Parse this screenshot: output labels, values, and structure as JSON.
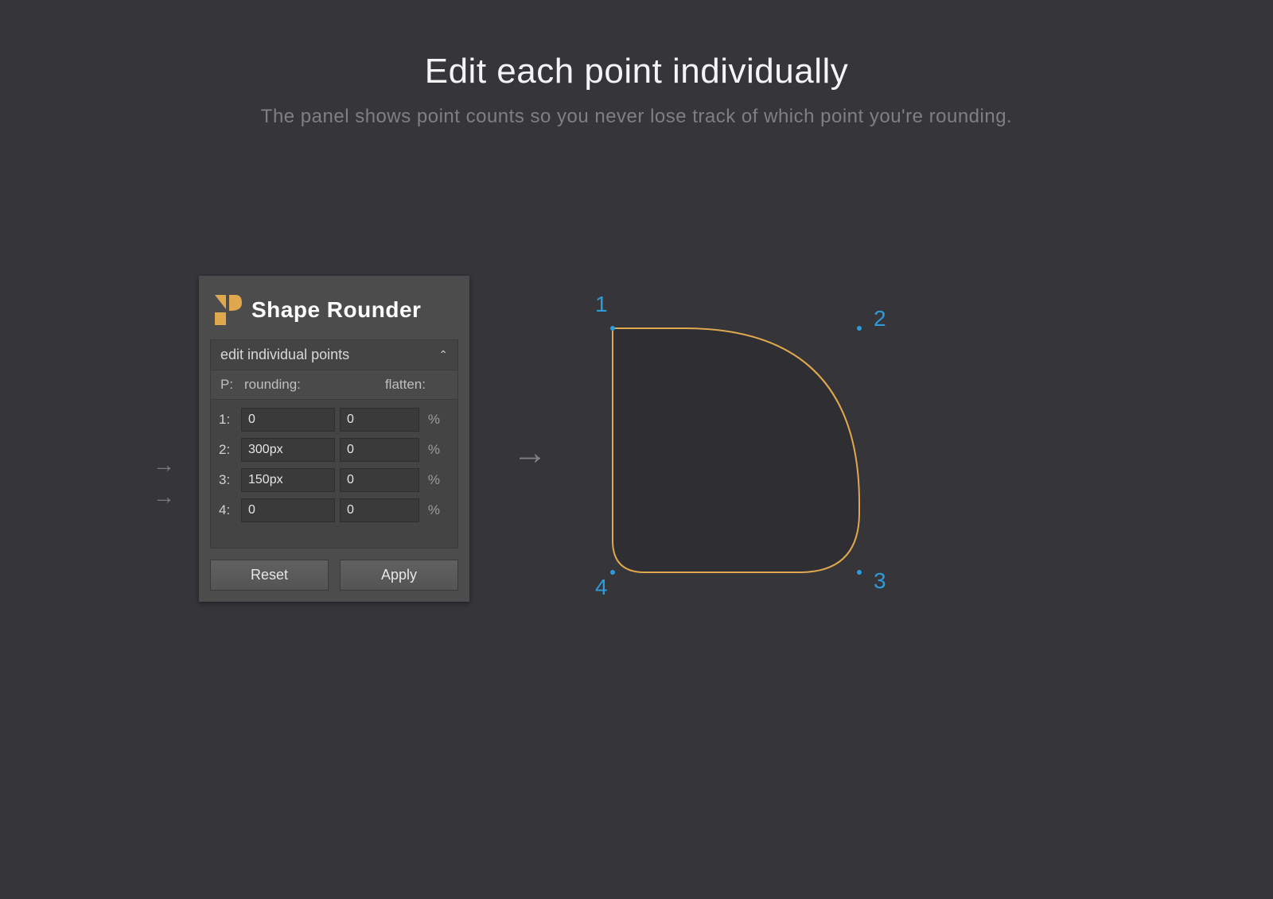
{
  "heading": {
    "title": "Edit each point individually",
    "subtitle": "The panel shows point counts so you never lose track of which point you're rounding."
  },
  "panel": {
    "title": "Shape Rounder",
    "section_title": "edit individual points",
    "columns": {
      "p": "P:",
      "rounding": "rounding:",
      "flatten": "flatten:"
    },
    "rows": [
      {
        "label": "1:",
        "rounding": "0",
        "flatten": "0",
        "unit": "%"
      },
      {
        "label": "2:",
        "rounding": "300px",
        "flatten": "0",
        "unit": "%"
      },
      {
        "label": "3:",
        "rounding": "150px",
        "flatten": "0",
        "unit": "%"
      },
      {
        "label": "4:",
        "rounding": "0",
        "flatten": "0",
        "unit": "%"
      }
    ],
    "reset_label": "Reset",
    "apply_label": "Apply"
  },
  "preview": {
    "labels": {
      "p1": "1",
      "p2": "2",
      "p3": "3",
      "p4": "4"
    },
    "colors": {
      "stroke": "#e0a84e",
      "fill": "#2e2e33",
      "accent": "#2d9cdb"
    }
  }
}
